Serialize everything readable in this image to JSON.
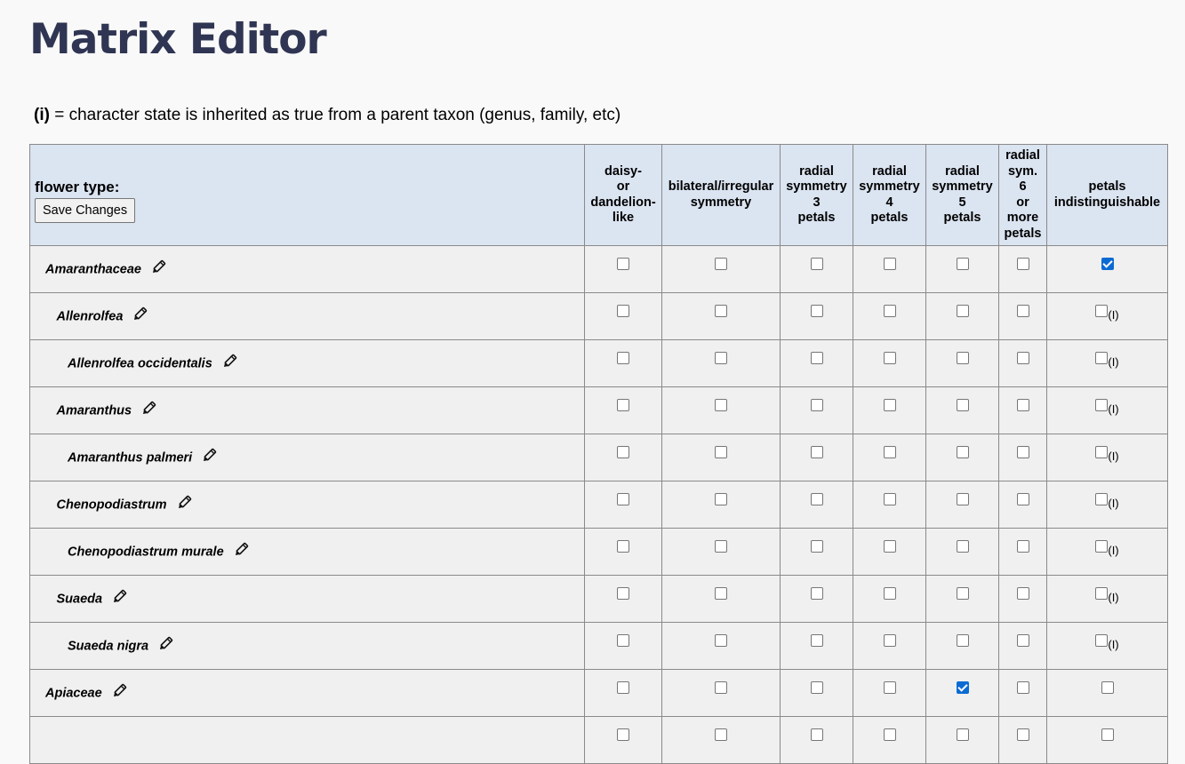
{
  "page": {
    "title": "Matrix Editor",
    "legend_key": "(i)",
    "legend_text": " = character state is inherited as true from a parent taxon (genus, family, etc)"
  },
  "header": {
    "character": "flower type:",
    "save_label": "Save Changes",
    "columns": [
      [
        "daisy-",
        "or",
        "dandelion-",
        "like"
      ],
      [
        "bilateral/irregular",
        "symmetry"
      ],
      [
        "radial",
        "symmetry",
        "3",
        "petals"
      ],
      [
        "radial",
        "symmetry",
        "4",
        "petals"
      ],
      [
        "radial",
        "symmetry",
        "5",
        "petals"
      ],
      [
        "radial",
        "sym.",
        "6",
        "or",
        "more",
        "petals"
      ],
      [
        "petals",
        "indistinguishable"
      ]
    ]
  },
  "inherited_marker": "(I)",
  "rows": [
    {
      "name": "Amaranthaceae",
      "level": 0,
      "states": [
        false,
        false,
        false,
        false,
        false,
        false,
        true
      ],
      "inherited": [
        false,
        false,
        false,
        false,
        false,
        false,
        false
      ]
    },
    {
      "name": "Allenrolfea",
      "level": 1,
      "states": [
        false,
        false,
        false,
        false,
        false,
        false,
        false
      ],
      "inherited": [
        false,
        false,
        false,
        false,
        false,
        false,
        true
      ]
    },
    {
      "name": "Allenrolfea occidentalis",
      "level": 2,
      "states": [
        false,
        false,
        false,
        false,
        false,
        false,
        false
      ],
      "inherited": [
        false,
        false,
        false,
        false,
        false,
        false,
        true
      ]
    },
    {
      "name": "Amaranthus",
      "level": 1,
      "states": [
        false,
        false,
        false,
        false,
        false,
        false,
        false
      ],
      "inherited": [
        false,
        false,
        false,
        false,
        false,
        false,
        true
      ]
    },
    {
      "name": "Amaranthus palmeri",
      "level": 2,
      "states": [
        false,
        false,
        false,
        false,
        false,
        false,
        false
      ],
      "inherited": [
        false,
        false,
        false,
        false,
        false,
        false,
        true
      ]
    },
    {
      "name": "Chenopodiastrum",
      "level": 1,
      "states": [
        false,
        false,
        false,
        false,
        false,
        false,
        false
      ],
      "inherited": [
        false,
        false,
        false,
        false,
        false,
        false,
        true
      ]
    },
    {
      "name": "Chenopodiastrum murale",
      "level": 2,
      "states": [
        false,
        false,
        false,
        false,
        false,
        false,
        false
      ],
      "inherited": [
        false,
        false,
        false,
        false,
        false,
        false,
        true
      ]
    },
    {
      "name": "Suaeda",
      "level": 1,
      "states": [
        false,
        false,
        false,
        false,
        false,
        false,
        false
      ],
      "inherited": [
        false,
        false,
        false,
        false,
        false,
        false,
        true
      ]
    },
    {
      "name": "Suaeda nigra",
      "level": 2,
      "states": [
        false,
        false,
        false,
        false,
        false,
        false,
        false
      ],
      "inherited": [
        false,
        false,
        false,
        false,
        false,
        false,
        true
      ]
    },
    {
      "name": "Apiaceae",
      "level": 0,
      "states": [
        false,
        false,
        false,
        false,
        true,
        false,
        false
      ],
      "inherited": [
        false,
        false,
        false,
        false,
        false,
        false,
        false
      ]
    },
    {
      "name": "",
      "level": 0,
      "states": [
        false,
        false,
        false,
        false,
        false,
        false,
        false
      ],
      "inherited": [
        false,
        false,
        false,
        false,
        false,
        false,
        false
      ]
    }
  ]
}
